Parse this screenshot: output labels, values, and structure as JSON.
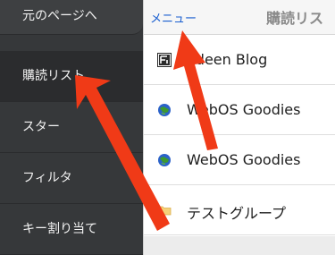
{
  "sidebar": {
    "back_label": "元のページへ",
    "items": [
      {
        "label": "購読リスト"
      },
      {
        "label": "スター"
      },
      {
        "label": "フィルタ"
      },
      {
        "label": "キー割り当て"
      }
    ]
  },
  "header": {
    "menu_label": "メニュー",
    "title": "購読リス"
  },
  "feeds": [
    {
      "label": "adeen Blog",
      "icon": "blog-favicon-icon"
    },
    {
      "label": "WebOS Goodies",
      "icon": "globe-icon"
    },
    {
      "label": "WebOS Goodies",
      "icon": "globe-icon"
    },
    {
      "label": "テストグループ",
      "icon": "folder-icon"
    }
  ],
  "colors": {
    "accent": "#1a5fd0",
    "annotation_arrow": "#f03a17",
    "sidebar_bg": "#36383a"
  }
}
